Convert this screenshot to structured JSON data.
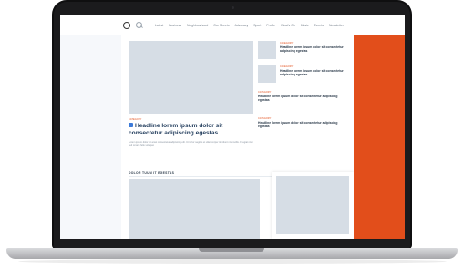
{
  "nav": {
    "items": [
      "Latest",
      "Business",
      "Neighbourhood",
      "Our Streets",
      "Advocacy",
      "Sport",
      "Profile",
      "What's On",
      "Music",
      "Events",
      "Newsletter"
    ]
  },
  "main": {
    "side_stories": [
      {
        "kicker": "CATEGORY",
        "headline": "Headline lorem ipsum dolor sit consectetur adipiscing egestas"
      },
      {
        "kicker": "CATEGORY",
        "headline": "Headline lorem ipsum dolor sit consectetur adipiscing egestas"
      },
      {
        "kicker": "CATEGORY",
        "headline": "Headline lorem ipsum dolor sit consectetur adipiscing egestas"
      },
      {
        "kicker": "CATEGORY",
        "headline": "Headline lorem ipsum dolor sit consectetur adipiscing egestas"
      }
    ],
    "hero": {
      "kicker": "CATEGORY",
      "headline": "Headline lorem ipsum dolor sit consectetur adipiscing egestas",
      "text": "Lorem ipsum dolor sit amet consectetur adipiscing elit. Ut tortor sagittis et ullamcorper tincidunt nisl mollis. Feugiat nisi sed ornare felis volutpat."
    },
    "section_title": "DOLOR TUUM IT EGESTAS"
  },
  "colors": {
    "accent": "#e24e1b",
    "link_blue": "#3d7bd9"
  }
}
